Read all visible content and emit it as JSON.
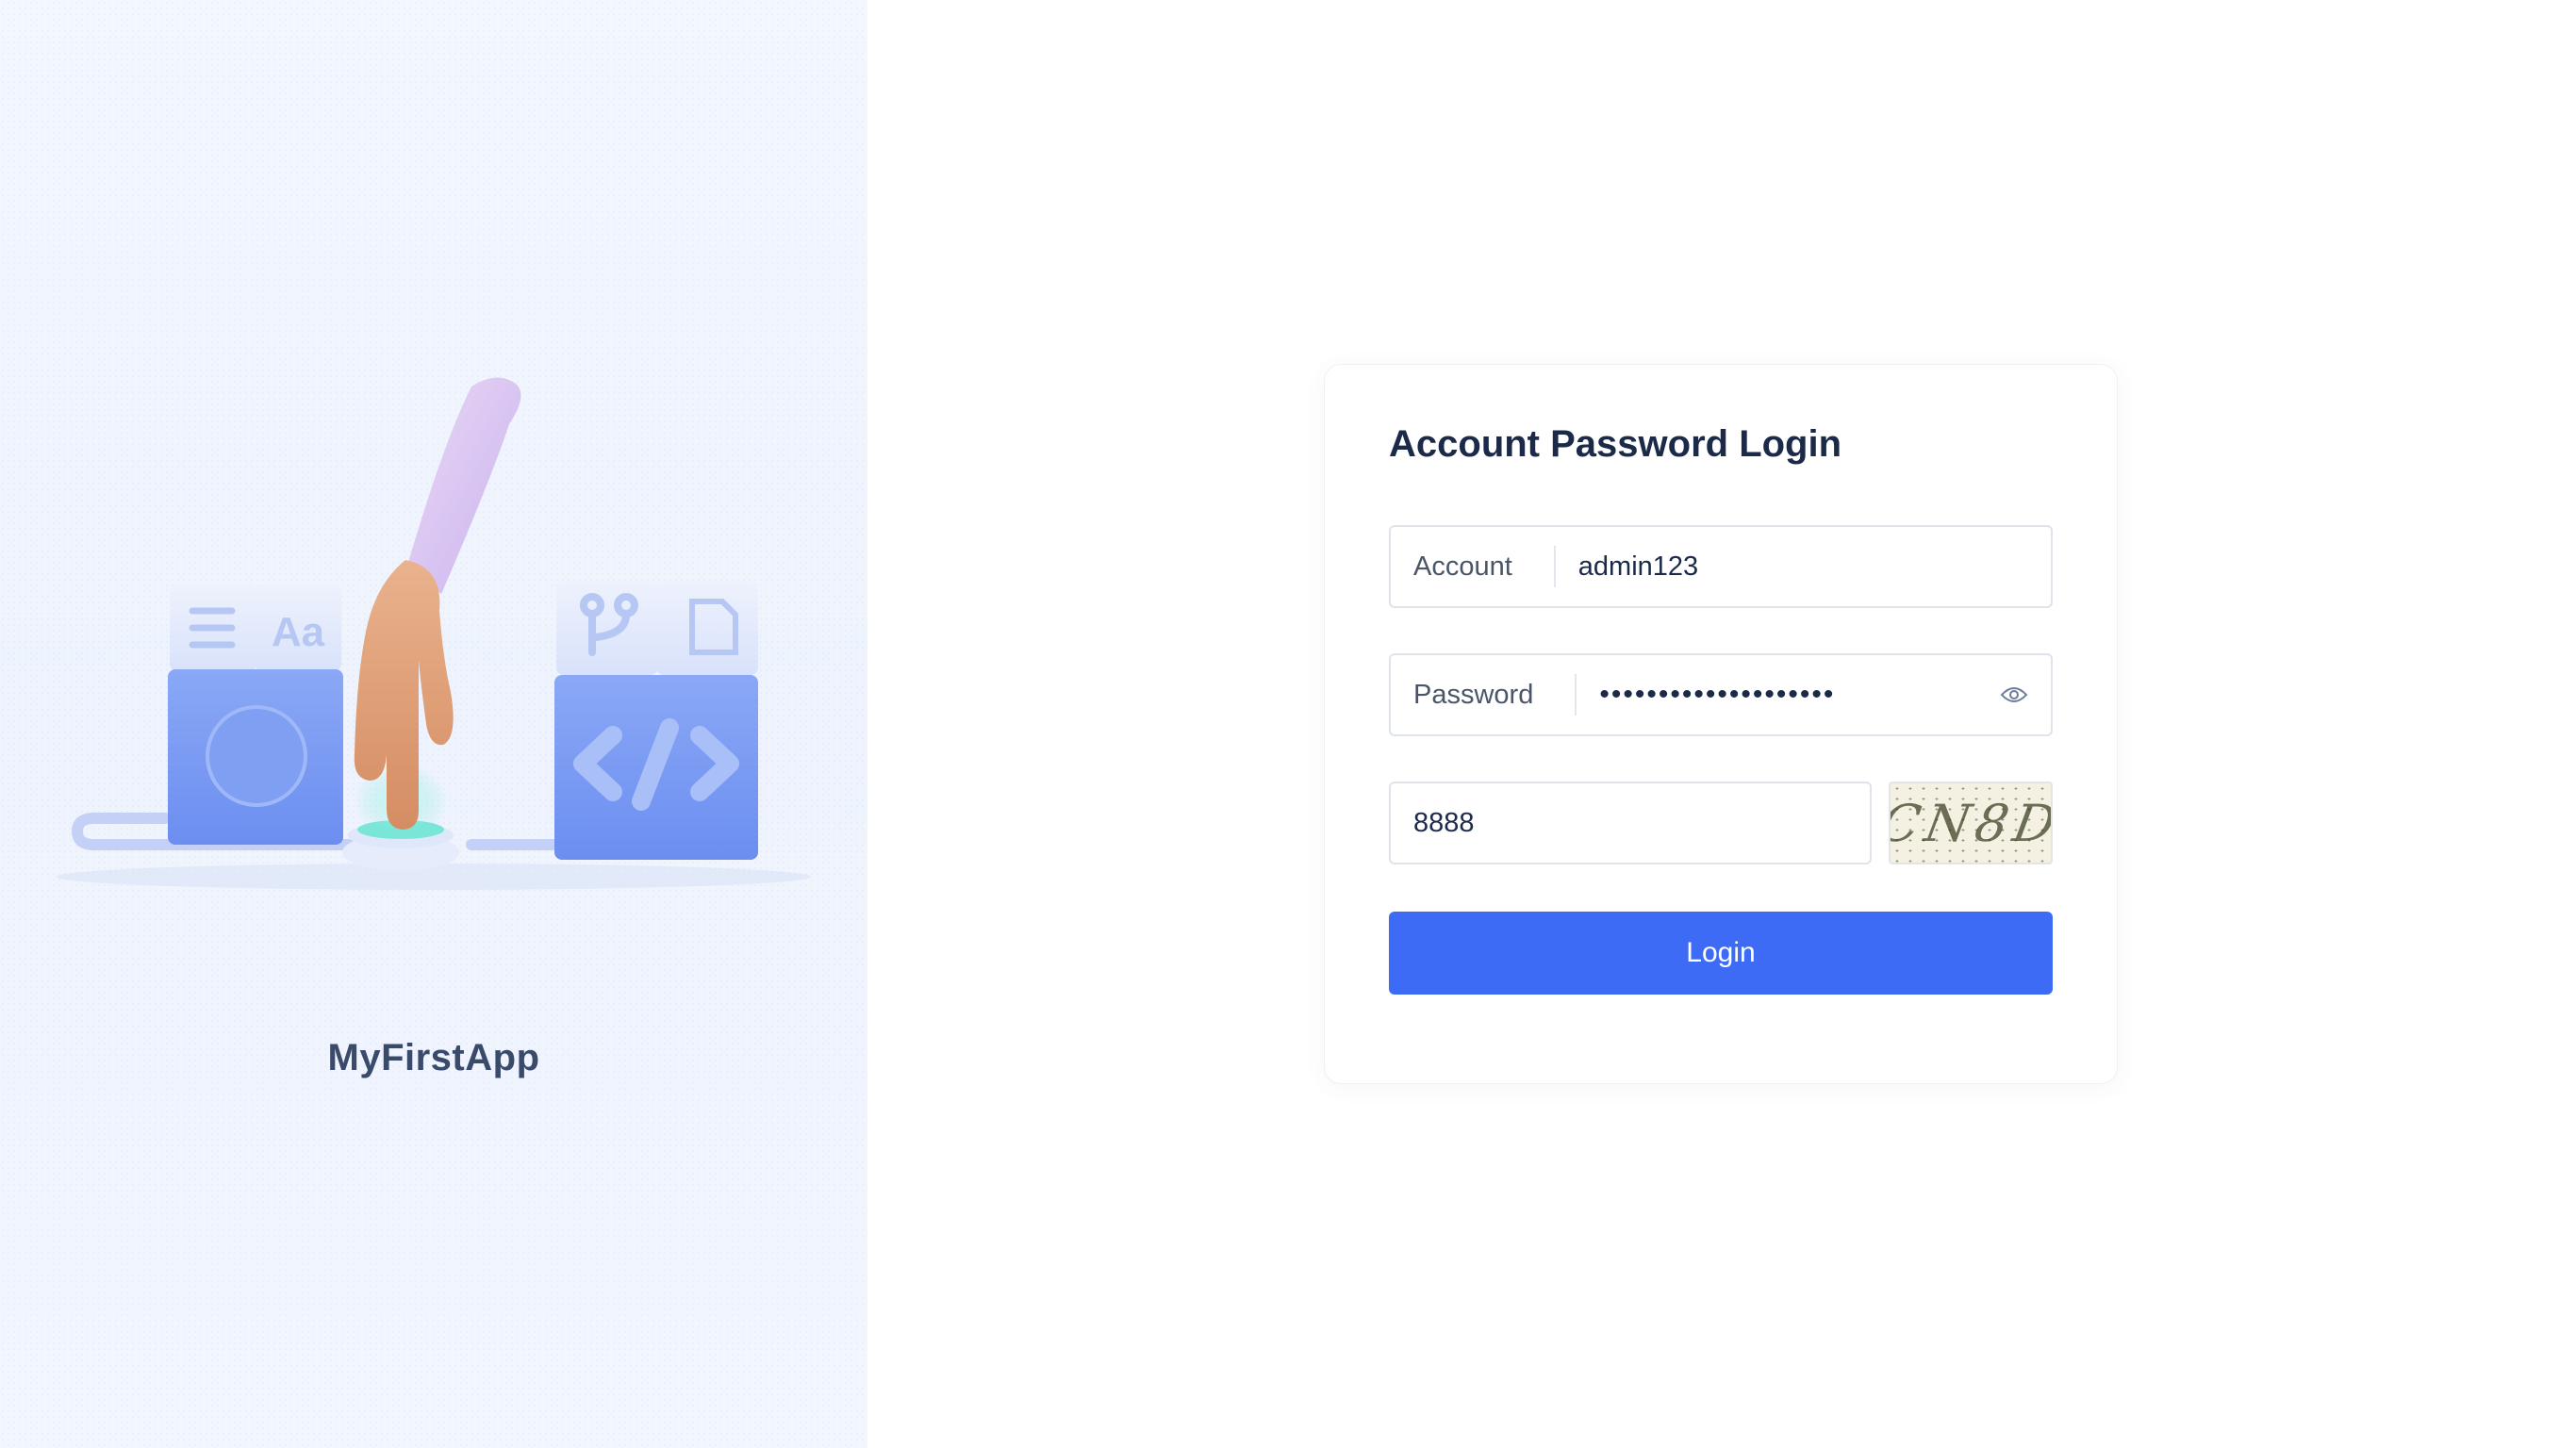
{
  "sidebar": {
    "app_name": "MyFirstApp"
  },
  "login": {
    "title": "Account Password Login",
    "account": {
      "label": "Account",
      "value": "admin123"
    },
    "password": {
      "label": "Password",
      "value": "••••••••••••••••••••"
    },
    "captcha": {
      "value": "8888",
      "image_text": "CN8D"
    },
    "button_label": "Login"
  },
  "icons": {
    "show_password": "eye-icon"
  },
  "colors": {
    "primary": "#3d6bf5",
    "title": "#1c2a4a",
    "left_panel_bg": "#eef3fd"
  }
}
